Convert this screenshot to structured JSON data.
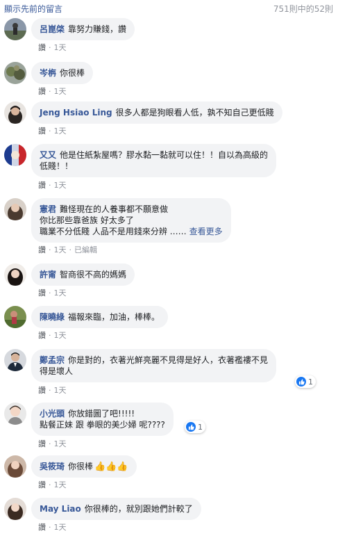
{
  "header": {
    "show_previous": "顯示先前的留言",
    "count": "751則中的52則"
  },
  "action_labels": {
    "like": "讚",
    "dot": "·"
  },
  "comments": [
    {
      "author": "呂崑棨",
      "text": "靠努力賺錢，讚",
      "time": "1天"
    },
    {
      "author": "岑栴",
      "text": "你很棒",
      "time": "1天"
    },
    {
      "author": "Jeng Hsiao Ling",
      "text": "很多人都是狗眼看人低，孰不知自己更低賤",
      "time": "1天"
    },
    {
      "author": "又又",
      "text_line1": "他是住紙紮屋嗎？膠水黏一黏就可以住！！自以為高級的",
      "text_line2": "低賤！！",
      "time": "1天"
    },
    {
      "author": "憲君",
      "text_line1": "難怪現在的人養事都不願意做",
      "text_line2": "你比那些靠爸族 好太多了",
      "text_line3": "職業不分低賤 人品不是用錢來分辨 ……",
      "see_more": "查看更多",
      "time": "1天",
      "edited": "已編輯"
    },
    {
      "author": "許甯",
      "text": "智商很不高的媽媽",
      "time": "1天"
    },
    {
      "author": "陳曉綠",
      "text": "福報來臨，加油，棒棒。",
      "time": "1天"
    },
    {
      "author": "鄭孟宗",
      "text_line1": "你是對的，衣著光鮮亮麗不見得是好人，衣著襤褸不見",
      "text_line2": "得是壞人",
      "time": "1天",
      "reactions": "1"
    },
    {
      "author": "小光頭",
      "text_line1": "你放錯圖了吧!!!!!",
      "text_line2": "點餐正妹 跟 拳眼的美少婦 呢????",
      "time": "1天",
      "reactions": "1"
    },
    {
      "author": "吳筱琦",
      "text": "你很棒",
      "emojis": "👍👍👍",
      "time": "1天"
    },
    {
      "author": "May Liao",
      "text": "你很棒的，就別跟她們計較了",
      "time": "1天"
    }
  ]
}
